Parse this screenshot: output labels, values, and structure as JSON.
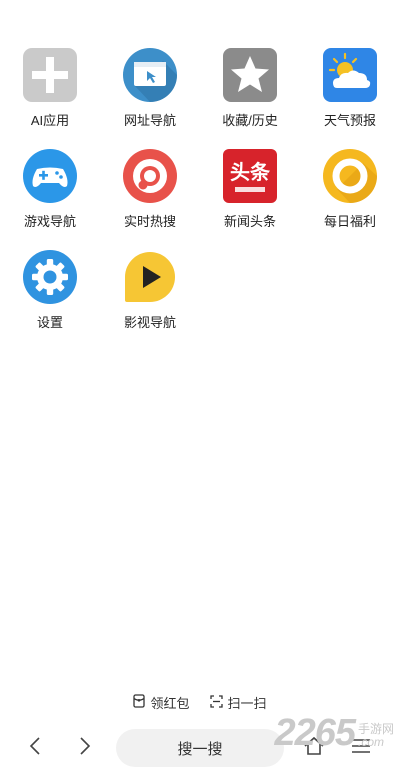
{
  "apps": [
    {
      "label": "AI应用",
      "icon": "plus-icon",
      "color": "#c8c8c8"
    },
    {
      "label": "网址导航",
      "icon": "browser-window-icon",
      "color": "#3c8fc8"
    },
    {
      "label": "收藏/历史",
      "icon": "star-icon",
      "color": "#8a8a8a"
    },
    {
      "label": "天气预报",
      "icon": "weather-sun-cloud-icon",
      "color": "#2f86e6"
    },
    {
      "label": "游戏导航",
      "icon": "gamepad-icon",
      "color": "#2a96e8"
    },
    {
      "label": "实时热搜",
      "icon": "hot-search-icon",
      "color": "#e8514a"
    },
    {
      "label": "新闻头条",
      "icon": "toutiao-logo-icon",
      "color": "#d7232b"
    },
    {
      "label": "每日福利",
      "icon": "ring-icon",
      "color": "#f5b81f"
    },
    {
      "label": "设置",
      "icon": "gear-icon",
      "color": "#2f92e0"
    },
    {
      "label": "影视导航",
      "icon": "play-icon",
      "color": "#f6c634"
    }
  ],
  "aux": {
    "red_packet": "领红包",
    "scan": "扫一扫"
  },
  "bottom": {
    "search_label": "搜一搜"
  },
  "watermark": {
    "number": "2265",
    "cn": "手游网",
    "com": ".com"
  },
  "toutiao_text": "头条"
}
